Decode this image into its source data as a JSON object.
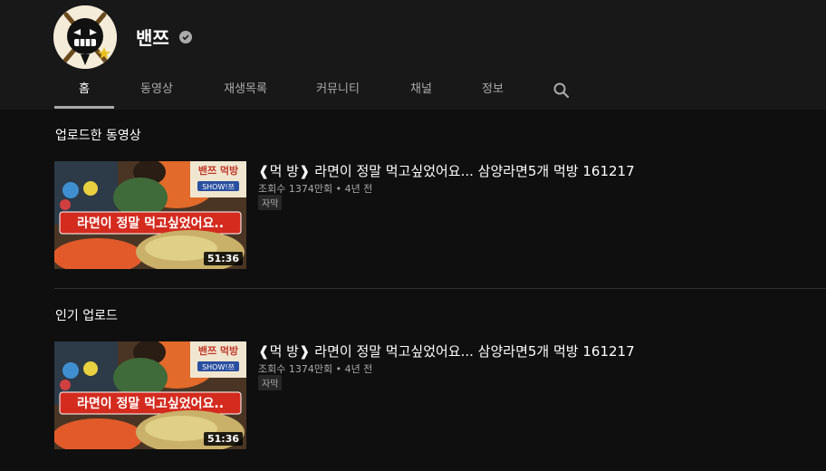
{
  "channel": {
    "name": "밴쯔"
  },
  "tabs": [
    {
      "label": "홈"
    },
    {
      "label": "동영상"
    },
    {
      "label": "재생목록"
    },
    {
      "label": "커뮤니티"
    },
    {
      "label": "채널"
    },
    {
      "label": "정보"
    }
  ],
  "sections": [
    {
      "title": "업로드한 동영상",
      "video": {
        "title": "❰먹 방❱ 라면이 정말 먹고싶었어요... 삼양라면5개 먹방 161217",
        "meta": "조회수 1374만회 • 4년 전",
        "badge": "자막",
        "duration": "51:36",
        "thumb_caption": "라면이 정말 먹고싶었어요..",
        "thumb_logo": "밴쯔 먹방",
        "thumb_logo_sub": "SHOW!쯔"
      }
    },
    {
      "title": "인기 업로드",
      "video": {
        "title": "❰먹 방❱ 라면이 정말 먹고싶었어요... 삼양라면5개 먹방 161217",
        "meta": "조회수 1374만회 • 4년 전",
        "badge": "자막",
        "duration": "51:36",
        "thumb_caption": "라면이 정말 먹고싶었어요..",
        "thumb_logo": "밴쯔 먹방",
        "thumb_logo_sub": "SHOW!쯔"
      }
    }
  ],
  "colors": {
    "background": "#0f0f0f",
    "header": "#181818",
    "text_secondary": "#aaaaaa"
  },
  "icons": {
    "search": "search-icon",
    "verified": "verified-check-icon"
  }
}
